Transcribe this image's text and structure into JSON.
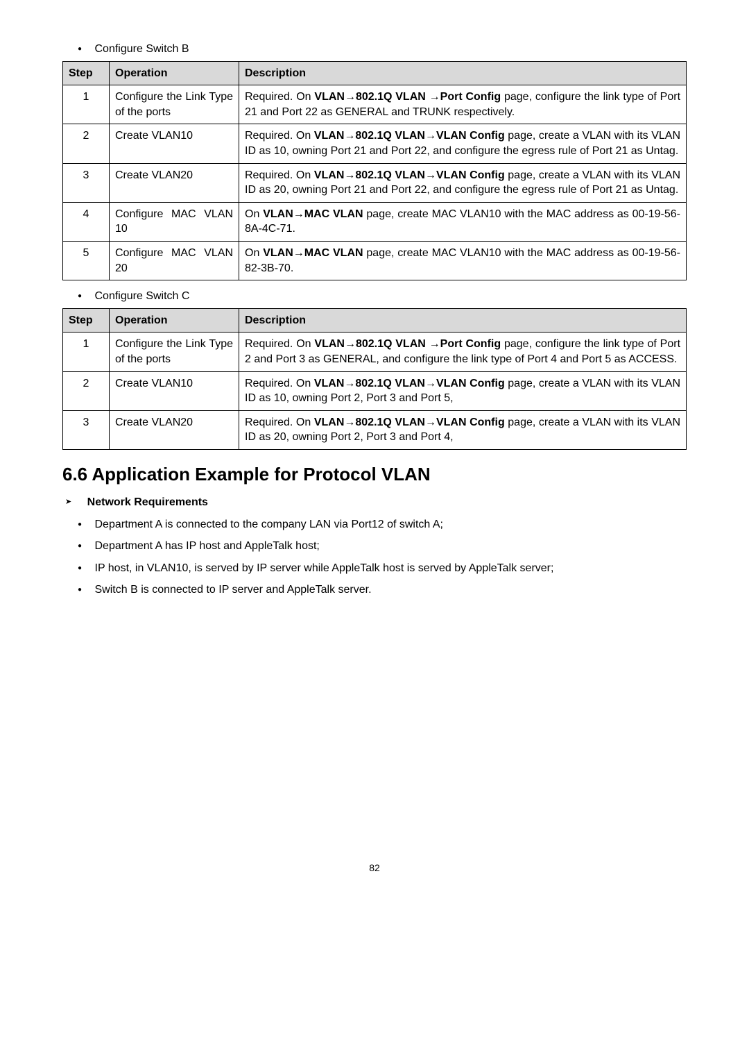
{
  "lead_b": "Configure Switch B",
  "table_b": {
    "headers": {
      "step": "Step",
      "operation": "Operation",
      "description": "Description"
    },
    "rows": [
      {
        "step": "1",
        "operation": "Configure the Link Type of the ports",
        "desc_pre": "Required. On ",
        "desc_bold1": "VLAN→802.1Q VLAN →Port Config",
        "desc_mid1": " page, configure the link type of Port 21 and Port 22 as GENERAL and TRUNK respectively."
      },
      {
        "step": "2",
        "operation": "Create VLAN10",
        "desc_pre": "Required. On ",
        "desc_bold1": "VLAN→802.1Q VLAN→VLAN Config",
        "desc_mid1": " page, create a VLAN with its VLAN ID as 10, owning Port 21 and Port 22, and configure the egress rule of Port 21 as Untag."
      },
      {
        "step": "3",
        "operation": "Create VLAN20",
        "desc_pre": "Required. On ",
        "desc_bold1": "VLAN→802.1Q VLAN→VLAN Config",
        "desc_mid1": " page, create a VLAN with its VLAN ID as 20, owning Port 21 and Port 22, and configure the egress rule of Port 21 as Untag."
      },
      {
        "step": "4",
        "operation": "Configure MAC VLAN 10",
        "desc_pre": "On ",
        "desc_bold1": "VLAN→MAC VLAN",
        "desc_mid1": " page, create MAC VLAN10 with the MAC address as 00-19-56-8A-4C-71."
      },
      {
        "step": "5",
        "operation": "Configure MAC VLAN 20",
        "desc_pre": "On ",
        "desc_bold1": "VLAN→MAC VLAN",
        "desc_mid1": " page, create MAC VLAN10 with the MAC address as 00-19-56-82-3B-70."
      }
    ]
  },
  "lead_c": "Configure Switch C",
  "table_c": {
    "headers": {
      "step": "Step",
      "operation": "Operation",
      "description": "Description"
    },
    "rows": [
      {
        "step": "1",
        "operation": "Configure the Link Type of the ports",
        "desc_pre": "Required. On ",
        "desc_bold1": "VLAN→802.1Q VLAN →Port Config",
        "desc_mid1": " page, configure the link type of Port 2 and Port 3 as GENERAL, and configure the link type of Port 4 and Port 5 as ACCESS."
      },
      {
        "step": "2",
        "operation": "Create VLAN10",
        "desc_pre": "Required. On ",
        "desc_bold1": "VLAN→802.1Q VLAN→VLAN Config",
        "desc_mid1": " page, create a VLAN with its VLAN ID as 10, owning Port 2, Port 3 and Port 5,"
      },
      {
        "step": "3",
        "operation": "Create VLAN20",
        "desc_pre": "Required. On ",
        "desc_bold1": "VLAN→802.1Q VLAN→VLAN Config",
        "desc_mid1": " page, create a VLAN with its VLAN ID as 20, owning Port 2, Port 3 and Port 4,"
      }
    ]
  },
  "heading": "6.6 Application Example for Protocol VLAN",
  "netreq_label": "Network Requirements",
  "reqs": [
    "Department A is connected to the company LAN via Port12 of switch A;",
    "Department A has IP host and AppleTalk host;",
    "IP host, in VLAN10, is served by IP server while AppleTalk host is served by AppleTalk server;",
    "Switch B is connected to IP server and AppleTalk server."
  ],
  "page_number": "82"
}
